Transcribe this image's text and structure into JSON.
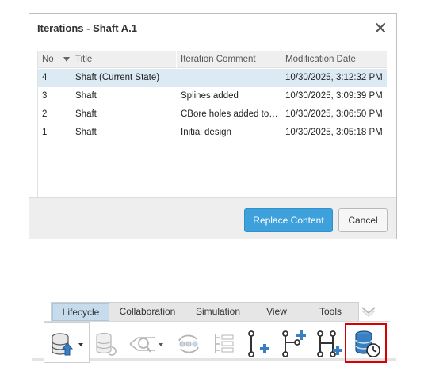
{
  "dialog": {
    "title": "Iterations - Shaft A.1",
    "columns": {
      "no": "No",
      "title": "Title",
      "comment": "Iteration Comment",
      "date": "Modification Date"
    },
    "rows": [
      {
        "no": "4",
        "title": "Shaft (Current State)",
        "comment": "",
        "date": "10/30/2025, 3:12:32 PM",
        "selected": true
      },
      {
        "no": "3",
        "title": "Shaft",
        "comment": "Splines added",
        "date": "10/30/2025, 3:09:39 PM",
        "selected": false
      },
      {
        "no": "2",
        "title": "Shaft",
        "comment": "CBore holes added to…",
        "date": "10/30/2025, 3:06:50 PM",
        "selected": false
      },
      {
        "no": "1",
        "title": "Shaft",
        "comment": "Initial design",
        "date": "10/30/2025, 3:05:18 PM",
        "selected": false
      }
    ],
    "replace_label": "Replace Content",
    "cancel_label": "Cancel"
  },
  "ribbon": {
    "tabs": [
      "Lifecycle",
      "Collaboration",
      "Simulation",
      "View",
      "Tools"
    ],
    "active_tab": "Lifecycle",
    "tools": [
      {
        "icon": "database-upload-icon",
        "state": "enabled",
        "has_dropdown": true
      },
      {
        "icon": "database-refresh-icon",
        "state": "disabled",
        "has_dropdown": false
      },
      {
        "icon": "search-tree-icon",
        "state": "disabled",
        "has_dropdown": true
      },
      {
        "icon": "cycle-sync-icon",
        "state": "disabled",
        "has_dropdown": false
      },
      {
        "icon": "tree-list-icon",
        "state": "disabled",
        "has_dropdown": false
      },
      {
        "icon": "add-node-icon",
        "state": "enabled",
        "has_dropdown": false
      },
      {
        "icon": "add-branch-icon",
        "state": "enabled",
        "has_dropdown": false
      },
      {
        "icon": "add-h-branch-icon",
        "state": "enabled",
        "has_dropdown": false
      },
      {
        "icon": "database-history-icon",
        "state": "enabled",
        "highlighted": true
      }
    ]
  },
  "colors": {
    "accent": "#3fa1db",
    "selected_row": "#dbeaf3",
    "active_tab": "#c6dcec",
    "highlight": "#d90000"
  }
}
